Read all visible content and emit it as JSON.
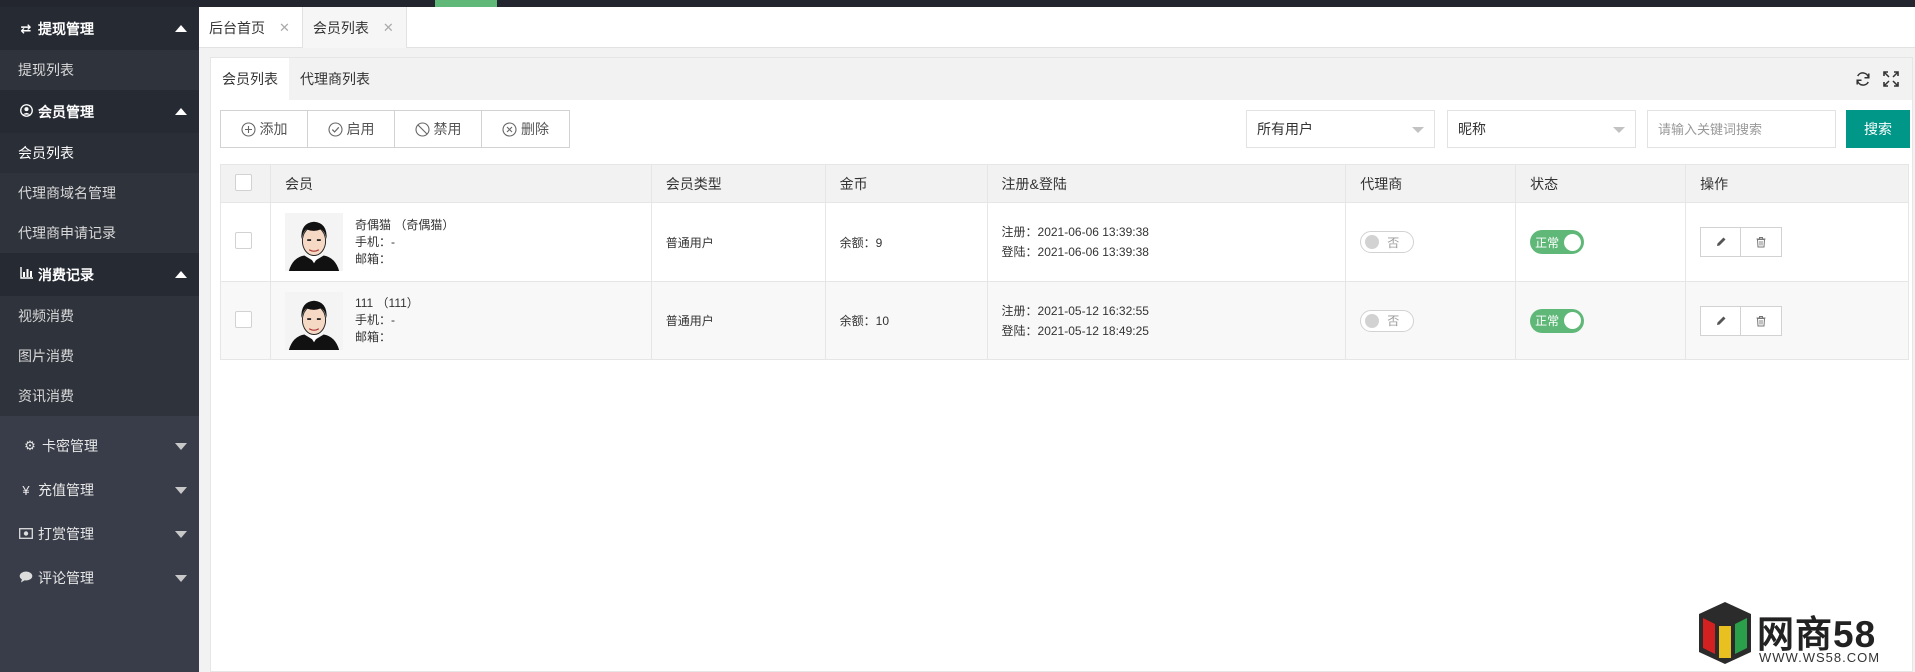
{
  "colors": {
    "sidebar_bg": "#393d49",
    "accent_green": "#5fb878",
    "search_button": "#009688"
  },
  "sidebar": {
    "groups": [
      {
        "title": "提现管理",
        "icon": "exchange-icon",
        "expanded": true,
        "items": [
          {
            "label": "提现列表"
          }
        ]
      },
      {
        "title": "会员管理",
        "icon": "user-circle-icon",
        "expanded": true,
        "items": [
          {
            "label": "会员列表"
          },
          {
            "label": "代理商域名管理"
          },
          {
            "label": "代理商申请记录"
          }
        ]
      },
      {
        "title": "消费记录",
        "icon": "bar-chart-icon",
        "expanded": true,
        "items": [
          {
            "label": "视频消费"
          },
          {
            "label": "图片消费"
          },
          {
            "label": "资讯消费"
          }
        ]
      },
      {
        "title": "卡密管理",
        "icon": "gear-icon",
        "expanded": false
      },
      {
        "title": "充值管理",
        "icon": "yen-icon",
        "expanded": false
      },
      {
        "title": "打赏管理",
        "icon": "money-icon",
        "expanded": false
      },
      {
        "title": "评论管理",
        "icon": "comment-icon",
        "expanded": false
      }
    ]
  },
  "page_tabs": [
    {
      "label": "后台首页"
    },
    {
      "label": "会员列表",
      "active": true
    }
  ],
  "card_tabs": [
    {
      "label": "会员列表",
      "active": true
    },
    {
      "label": "代理商列表"
    }
  ],
  "toolbar": {
    "add": "添加",
    "enable": "启用",
    "disable": "禁用",
    "delete": "删除"
  },
  "filters": {
    "user_type": "所有用户",
    "field": "昵称",
    "search_placeholder": "请输入关键词搜索",
    "search_button": "搜索"
  },
  "table": {
    "headers": [
      "会员",
      "会员类型",
      "金币",
      "注册&登陆",
      "代理商",
      "状态",
      "操作"
    ],
    "rows": [
      {
        "name": "奇偶猫 （奇偶猫）",
        "phone": "手机：-",
        "email": "邮箱：",
        "type": "普通用户",
        "coins": "余额：9",
        "register": "注册：2021-06-06 13:39:38",
        "login": "登陆：2021-06-06 13:39:38",
        "agent": "否",
        "status": "正常"
      },
      {
        "name": "111 （111）",
        "phone": "手机：-",
        "email": "邮箱：",
        "type": "普通用户",
        "coins": "余额：10",
        "register": "注册：2021-05-12 16:32:55",
        "login": "登陆：2021-05-12 18:49:25",
        "agent": "否",
        "status": "正常"
      }
    ]
  },
  "watermark": {
    "text": "网商58",
    "url": "WWW.WS58.COM"
  }
}
